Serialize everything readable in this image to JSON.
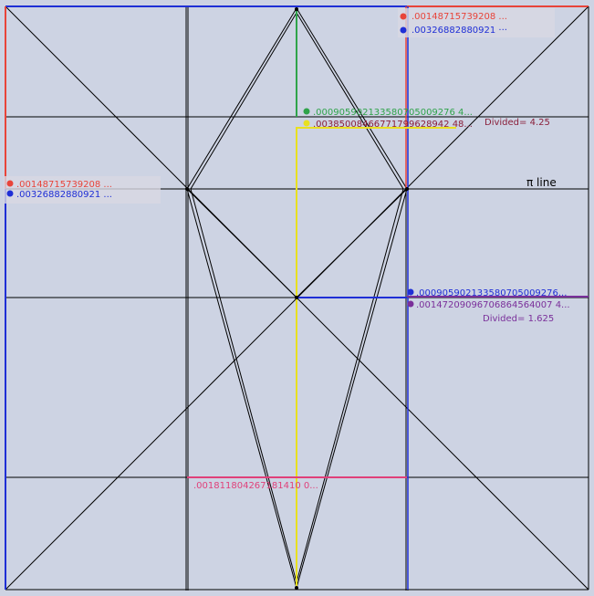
{
  "canvas": {
    "background": "#cdd3e3",
    "line_color": "#000000"
  },
  "colors": {
    "red": "#e8443a",
    "blue": "#1f2fd6",
    "green": "#2fa34a",
    "yellow": "#e8e020",
    "purple": "#7a2f9a",
    "magenta": "#e0407a",
    "maroon": "#8a1f3a",
    "label_box": "#d8d8e2"
  },
  "labels": {
    "top_right_red": ".00148715739208 ...",
    "top_right_blue": ".00326882880921 ···",
    "left_red": ".00148715739208 ...",
    "left_blue": ".00326882880921 ...",
    "green_value": ".000905902133580705009276 4...",
    "yellow_value": ".00385008466771799628942 48...",
    "divided_1": "Divided= 4.25",
    "pi_line": "π line",
    "right_blue": ".000905902133580705009276...",
    "right_purple": ".00147209096706864564007 4...",
    "divided_2": "Divided= 1.625",
    "bottom_magenta": ".001811804267181410 0..."
  }
}
